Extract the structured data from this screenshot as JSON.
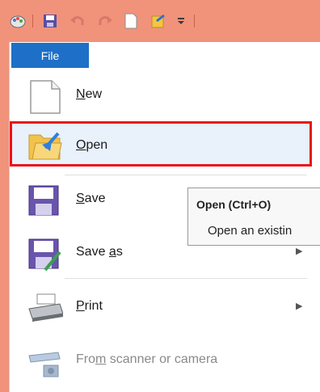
{
  "titlebar": {
    "icons": [
      "paint-app-icon",
      "save-icon",
      "undo-icon",
      "redo-icon",
      "new-document-icon",
      "open-folder-icon",
      "qat-dropdown-icon"
    ]
  },
  "file_tab": {
    "label": "File"
  },
  "menu": {
    "items": [
      {
        "name": "new",
        "pre": "",
        "ul": "N",
        "post": "ew",
        "icon": "new-document-icon"
      },
      {
        "name": "open",
        "pre": "",
        "ul": "O",
        "post": "pen",
        "icon": "open-folder-icon"
      },
      {
        "name": "save",
        "pre": "",
        "ul": "S",
        "post": "ave",
        "icon": "save-icon"
      },
      {
        "name": "save-as",
        "pre": "Save ",
        "ul": "a",
        "post": "s",
        "icon": "save-as-icon"
      },
      {
        "name": "print",
        "pre": "",
        "ul": "P",
        "post": "rint",
        "icon": "printer-icon"
      },
      {
        "name": "from-scanner",
        "pre": "Fro",
        "ul": "m",
        "post": " scanner or camera",
        "icon": "scanner-icon"
      }
    ]
  },
  "tooltip": {
    "title": "Open (Ctrl+O)",
    "body": "Open an existin"
  },
  "colors": {
    "titlebar": "#f0937a",
    "file_tab": "#1e6fc7",
    "highlight_border": "#e8131b"
  }
}
